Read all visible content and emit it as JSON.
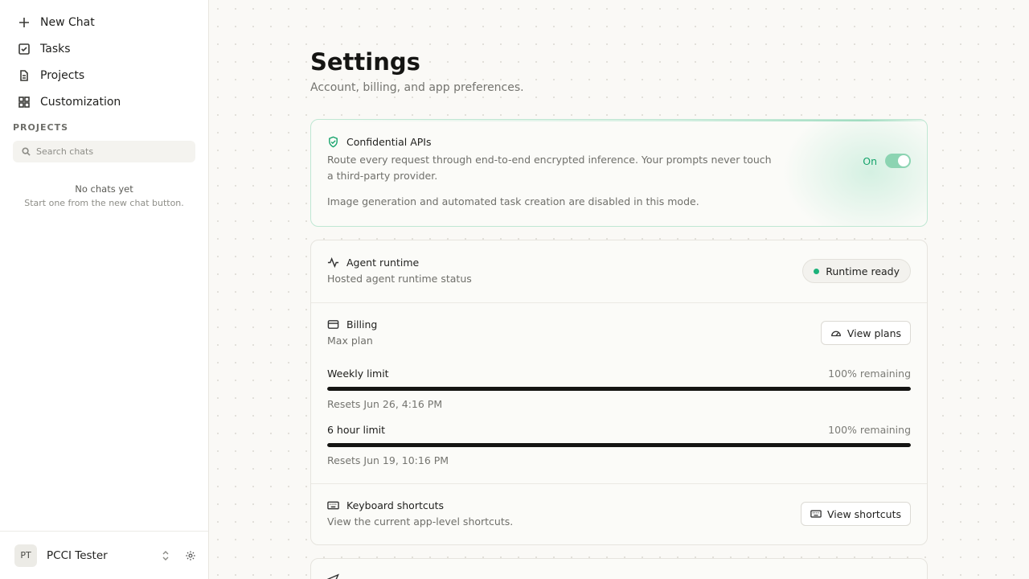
{
  "sidebar": {
    "nav": [
      {
        "label": "New Chat",
        "icon": "plus-icon"
      },
      {
        "label": "Tasks",
        "icon": "checkbox-icon"
      },
      {
        "label": "Projects",
        "icon": "document-icon"
      },
      {
        "label": "Customization",
        "icon": "grid-icon"
      }
    ],
    "section_label": "PROJECTS",
    "search_placeholder": "Search chats",
    "empty_title": "No chats yet",
    "empty_sub": "Start one from the new chat button.",
    "user": {
      "initials": "PT",
      "name": "PCCI Tester"
    }
  },
  "main": {
    "title": "Settings",
    "subtitle": "Account, billing, and app preferences.",
    "confidential": {
      "title": "Confidential APIs",
      "desc": "Route every request through end-to-end encrypted inference. Your prompts never touch a third-party provider.",
      "note": "Image generation and automated task creation are disabled in this mode.",
      "toggle_label": "On",
      "toggle_on": true,
      "accent": "#15a36b"
    },
    "runtime": {
      "title": "Agent runtime",
      "subtitle": "Hosted agent runtime status",
      "status": "Runtime ready",
      "status_color": "#1cb27a"
    },
    "billing": {
      "title": "Billing",
      "plan": "Max plan",
      "button": "View plans",
      "limits": [
        {
          "label": "Weekly limit",
          "remaining": "100% remaining",
          "reset": "Resets Jun 26, 4:16 PM",
          "fraction": 1.0
        },
        {
          "label": "6 hour limit",
          "remaining": "100% remaining",
          "reset": "Resets Jun 19, 10:16 PM",
          "fraction": 1.0
        }
      ]
    },
    "shortcuts": {
      "title": "Keyboard shortcuts",
      "subtitle": "View the current app-level shortcuts.",
      "button": "View shortcuts"
    }
  }
}
